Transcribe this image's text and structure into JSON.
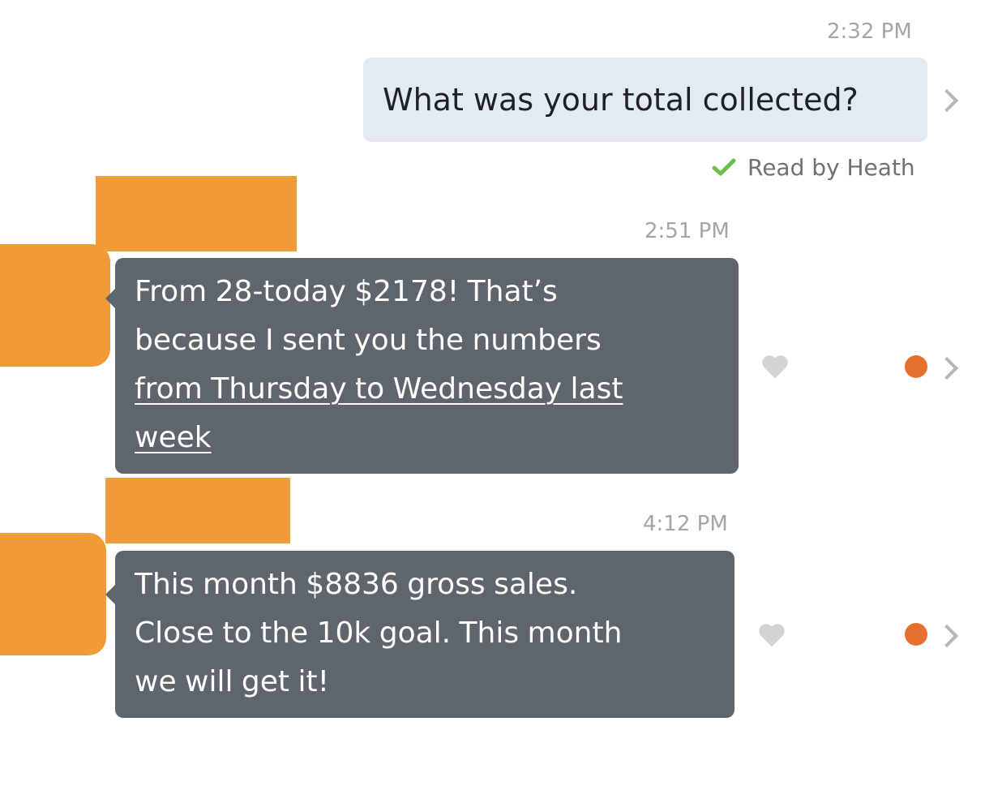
{
  "colors": {
    "outgoing_bubble": "#e4eaf2",
    "incoming_bubble": "#5f656d",
    "redaction": "#f09a38",
    "unread_dot": "#e8702f",
    "read_check": "#6cc04a",
    "timestamp": "#a2a6ab"
  },
  "icons": {
    "chevron": "chevron-right-icon",
    "check": "checkmark-icon",
    "heart": "heart-icon",
    "dot": "unread-dot-icon"
  },
  "messages": [
    {
      "direction": "outgoing",
      "time": "2:32 PM",
      "text": "What was your total collected?",
      "read_receipt": "Read by Heath"
    },
    {
      "direction": "incoming",
      "time": "2:51 PM",
      "lines": [
        "From 28-today $2178!  That’s",
        "because I sent you the numbers"
      ],
      "link_lines": [
        "from Thursday to Wednesday last",
        "week"
      ]
    },
    {
      "direction": "incoming",
      "time": "4:12 PM",
      "lines": [
        "This month $8836 gross sales.",
        "Close to the 10k goal. This month",
        "we will get it!"
      ]
    }
  ]
}
